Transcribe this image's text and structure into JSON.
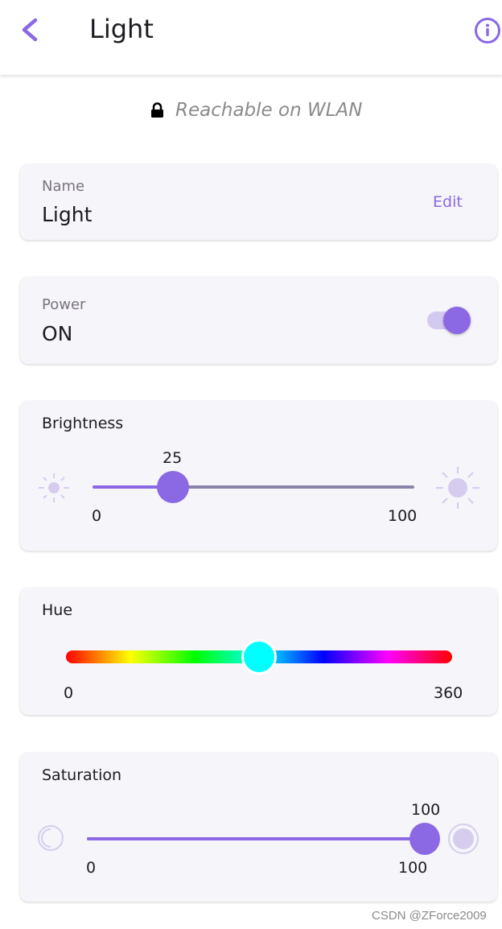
{
  "header": {
    "title": "Light",
    "back_icon": "chevron-left-icon",
    "info_icon": "info-icon"
  },
  "status": {
    "icon": "lock-icon",
    "text": "Reachable on WLAN"
  },
  "name_card": {
    "label": "Name",
    "value": "Light",
    "edit_label": "Edit"
  },
  "power_card": {
    "label": "Power",
    "value": "ON",
    "toggle_on": true
  },
  "brightness": {
    "title": "Brightness",
    "value": 25,
    "value_label": "25",
    "min": "0",
    "max": "100",
    "min_icon": "sun-small-icon",
    "max_icon": "sun-large-icon"
  },
  "hue": {
    "title": "Hue",
    "value": 180,
    "min": "0",
    "max": "360",
    "thumb_color": "#00ffff"
  },
  "saturation": {
    "title": "Saturation",
    "value": 100,
    "value_label": "100",
    "min": "0",
    "max": "100",
    "min_icon": "circle-empty-icon",
    "max_icon": "circle-filled-icon"
  },
  "watermark": "CSDN @ZForce2009",
  "colors": {
    "accent": "#8b68e4",
    "card_bg": "#f6f5fa"
  }
}
